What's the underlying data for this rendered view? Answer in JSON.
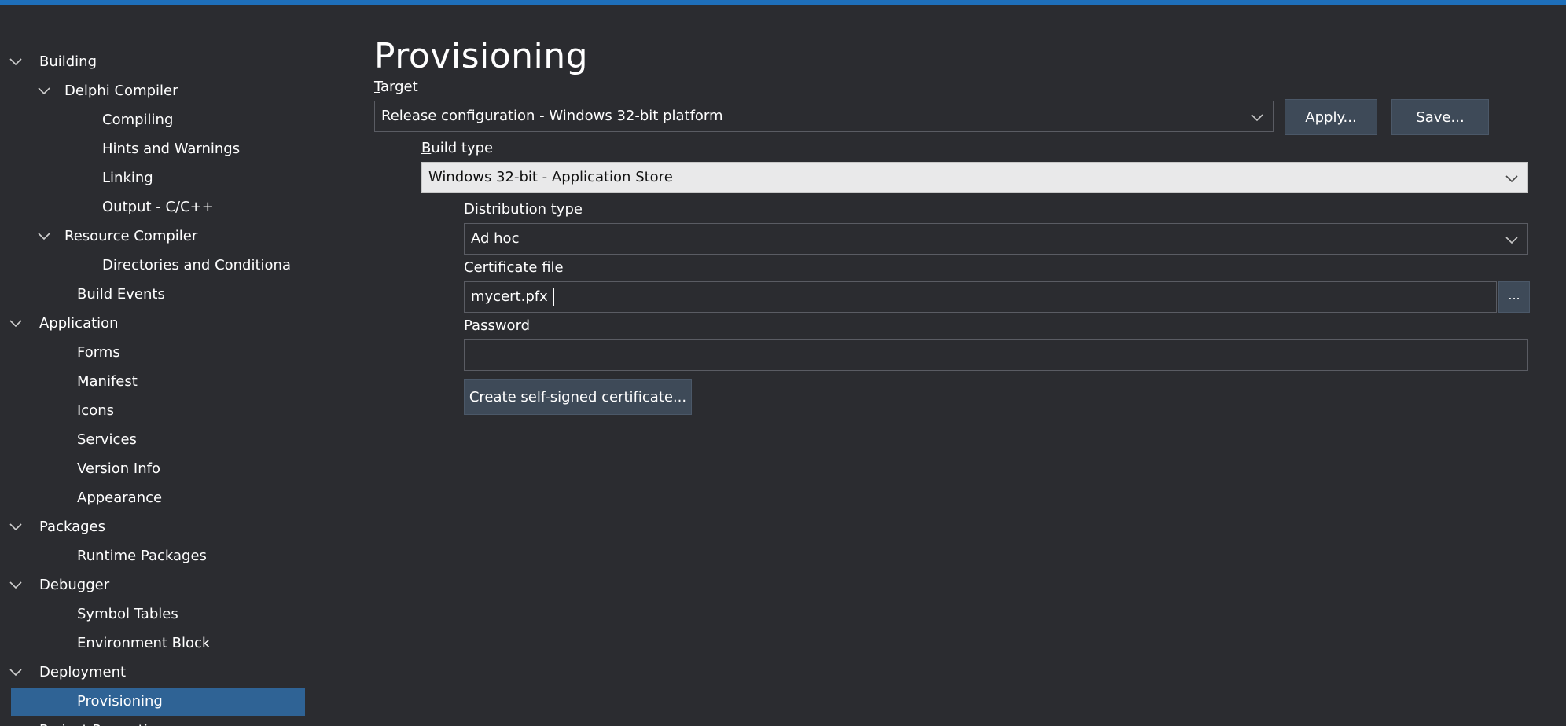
{
  "tree": [
    {
      "label": "Building",
      "level": 0,
      "expanded": true
    },
    {
      "label": "Delphi Compiler",
      "level": 1,
      "expanded": true
    },
    {
      "label": "Compiling",
      "level": 2
    },
    {
      "label": "Hints and Warnings",
      "level": 2
    },
    {
      "label": "Linking",
      "level": 2
    },
    {
      "label": "Output - C/C++",
      "level": 2
    },
    {
      "label": "Resource Compiler",
      "level": 1,
      "expanded": true
    },
    {
      "label": "Directories and Conditiona",
      "level": 2
    },
    {
      "label": "Build Events",
      "level": 1
    },
    {
      "label": "Application",
      "level": 0,
      "expanded": true
    },
    {
      "label": "Forms",
      "level": 1
    },
    {
      "label": "Manifest",
      "level": 1
    },
    {
      "label": "Icons",
      "level": 1
    },
    {
      "label": "Services",
      "level": 1
    },
    {
      "label": "Version Info",
      "level": 1
    },
    {
      "label": "Appearance",
      "level": 1
    },
    {
      "label": "Packages",
      "level": 0,
      "expanded": true
    },
    {
      "label": "Runtime Packages",
      "level": 1
    },
    {
      "label": "Debugger",
      "level": 0,
      "expanded": true
    },
    {
      "label": "Symbol Tables",
      "level": 1
    },
    {
      "label": "Environment Block",
      "level": 1
    },
    {
      "label": "Deployment",
      "level": 0,
      "expanded": true
    },
    {
      "label": "Provisioning",
      "level": 1,
      "selected": true
    },
    {
      "label": "Project Properties",
      "level": 0,
      "expanded": true
    }
  ],
  "page": {
    "title": "Provisioning"
  },
  "target": {
    "label_accel": "T",
    "label_rest": "arget",
    "value": "Release configuration - Windows 32-bit platform",
    "apply_accel": "A",
    "apply_rest": "pply...",
    "save_accel": "S",
    "save_rest": "ave..."
  },
  "build_type": {
    "label_accel": "B",
    "label_rest": "uild type",
    "value": "Windows 32-bit - Application Store"
  },
  "distribution": {
    "label": "Distribution type",
    "value": "Ad hoc"
  },
  "certificate": {
    "label": "Certificate file",
    "value": "mycert.pfx",
    "browse_label": "..."
  },
  "password": {
    "label": "Password",
    "value": ""
  },
  "create_cert_button": "Create self-signed certificate...",
  "colors": {
    "background": "#2b2c30",
    "accent": "#1e6fba",
    "selection": "#2f6395",
    "button": "#3e4a58"
  }
}
